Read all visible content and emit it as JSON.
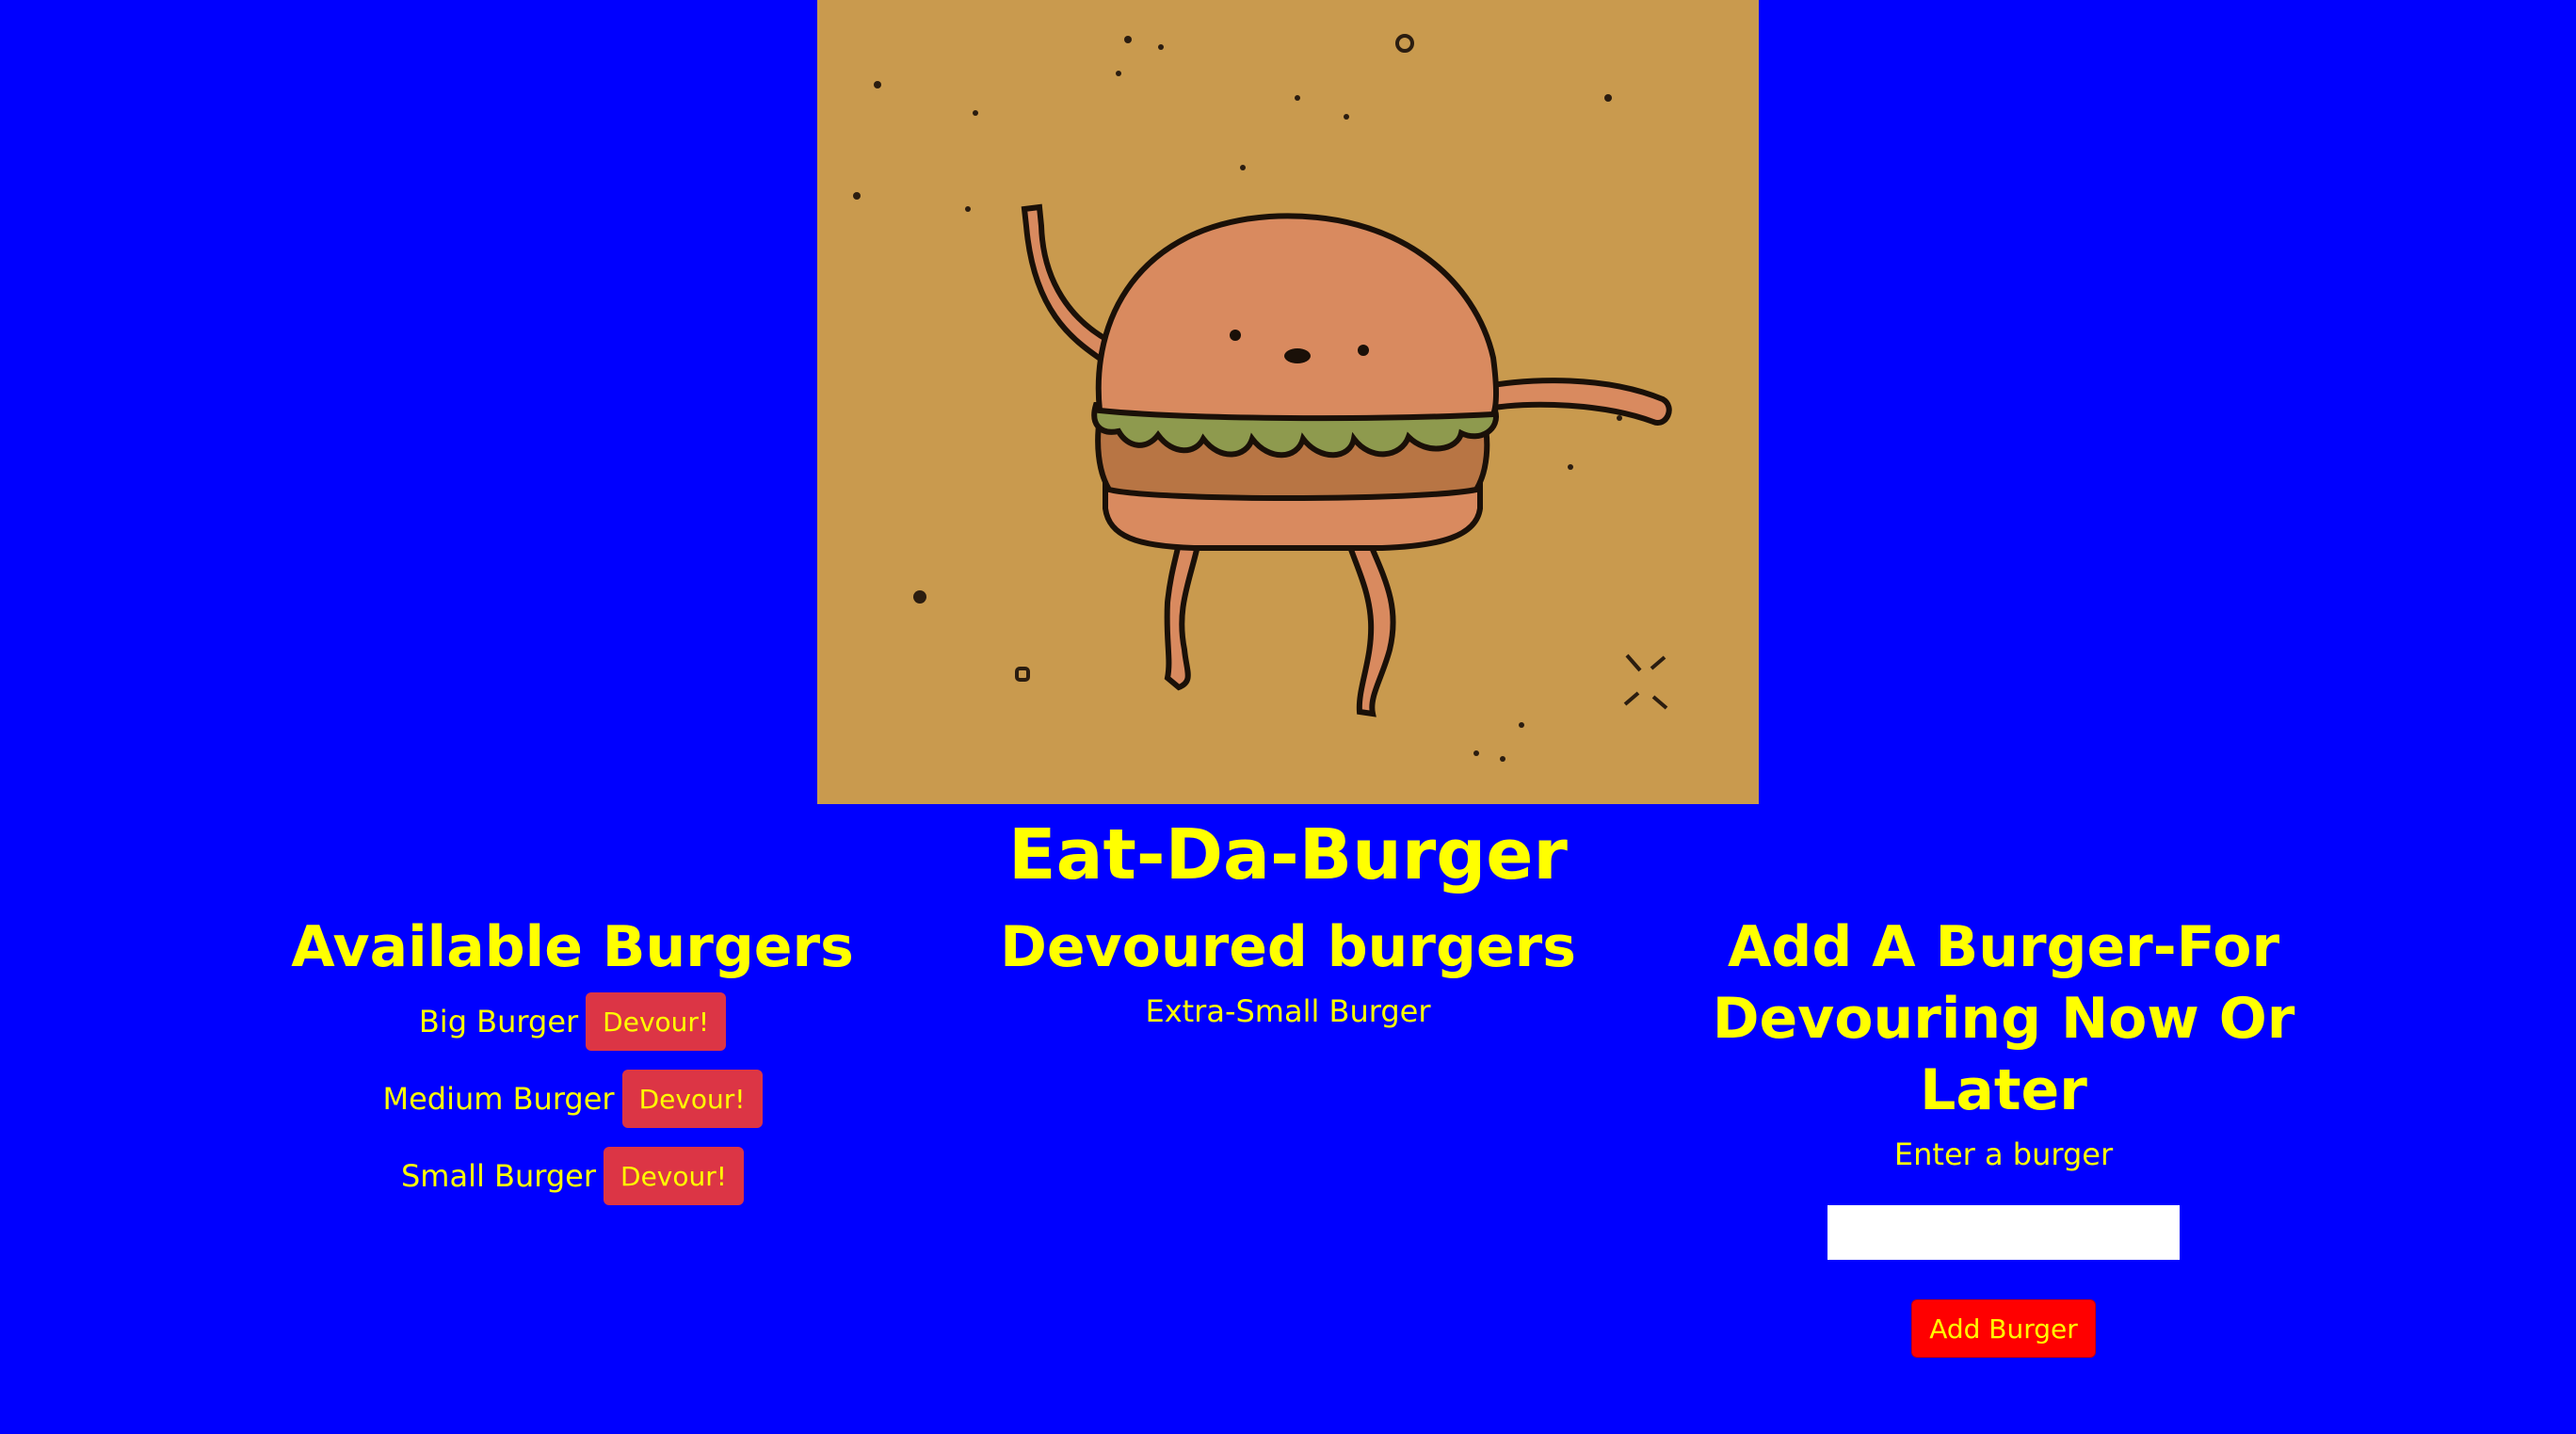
{
  "hero": {
    "image": "dancing-burger-illustration"
  },
  "header": {
    "title": "Eat-Da-Burger"
  },
  "available": {
    "heading": "Available Burgers",
    "items": [
      {
        "name": "Big Burger",
        "button": "Devour!"
      },
      {
        "name": "Medium Burger",
        "button": "Devour!"
      },
      {
        "name": "Small Burger",
        "button": "Devour!"
      }
    ]
  },
  "devoured": {
    "heading": "Devoured burgers",
    "items": [
      {
        "name": "Extra-Small Burger"
      }
    ]
  },
  "add": {
    "heading_line1": "Add A Burger-For",
    "heading_line2": "Devouring Now Or",
    "heading_line3": "Later",
    "label": "Enter a burger",
    "input_value": "",
    "button": "Add Burger"
  },
  "colors": {
    "background": "#0000ff",
    "text": "#ffff00",
    "devour_button": "#dc3545",
    "add_button": "#ff0000"
  }
}
